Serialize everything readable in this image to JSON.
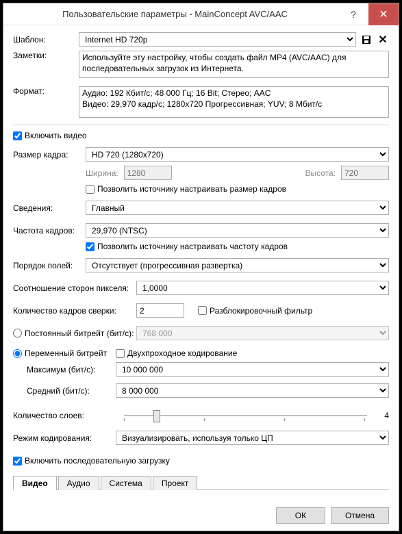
{
  "title": "Пользовательские параметры - MainConcept AVC/AAC",
  "labels": {
    "template": "Шаблон:",
    "notes": "Заметки:",
    "format": "Формат:",
    "include_video": "Включить видео",
    "frame_size": "Размер кадра:",
    "width": "Ширина:",
    "height": "Высота:",
    "allow_src_frame": "Позволить источнику настраивать размер кадров",
    "profile": "Сведения:",
    "framerate": "Частота кадров:",
    "allow_src_rate": "Позволить источнику настраивать частоту кадров",
    "fieldorder": "Порядок полей:",
    "pixel_aspect": "Соотношение сторон пикселя:",
    "reframes": "Количество кадров сверки:",
    "deblock": "Разблокировочный фильтр",
    "cbr": "Постоянный битрейт (бит/с):",
    "vbr": "Переменный битрейт",
    "twopass": "Двухпроходное кодирование",
    "max": "Максимум (бит/с):",
    "avg": "Средний (бит/с):",
    "slices": "Количество слоев:",
    "encmode": "Режим кодирования:",
    "progressive_dl": "Включить последовательную загрузку"
  },
  "values": {
    "template": "Internet HD 720p",
    "notes": "Используйте эту настройку, чтобы создать файл MP4 (AVC/AAC) для последовательных загрузок из Интернета.",
    "format": "Аудио: 192 Кбит/с; 48 000 Гц; 16 Bit; Стерео; AAC\nВидео: 29,970 кадр/с; 1280x720 Прогрессивная; YUV; 8 Мбит/с",
    "frame_size": "HD 720 (1280x720)",
    "width": "1280",
    "height": "720",
    "profile": "Главный",
    "framerate": "29,970 (NTSC)",
    "fieldorder": "Отсутствует (прогрессивная развертка)",
    "pixel_aspect": "1,0000",
    "reframes": "2",
    "cbr_value": "768 000",
    "max": "10 000 000",
    "avg": "8 000 000",
    "slices": "4",
    "encmode": "Визуализировать, используя только ЦП"
  },
  "tabs": {
    "video": "Видео",
    "audio": "Аудио",
    "system": "Система",
    "project": "Проект"
  },
  "buttons": {
    "ok": "ОК",
    "cancel": "Отмена"
  }
}
